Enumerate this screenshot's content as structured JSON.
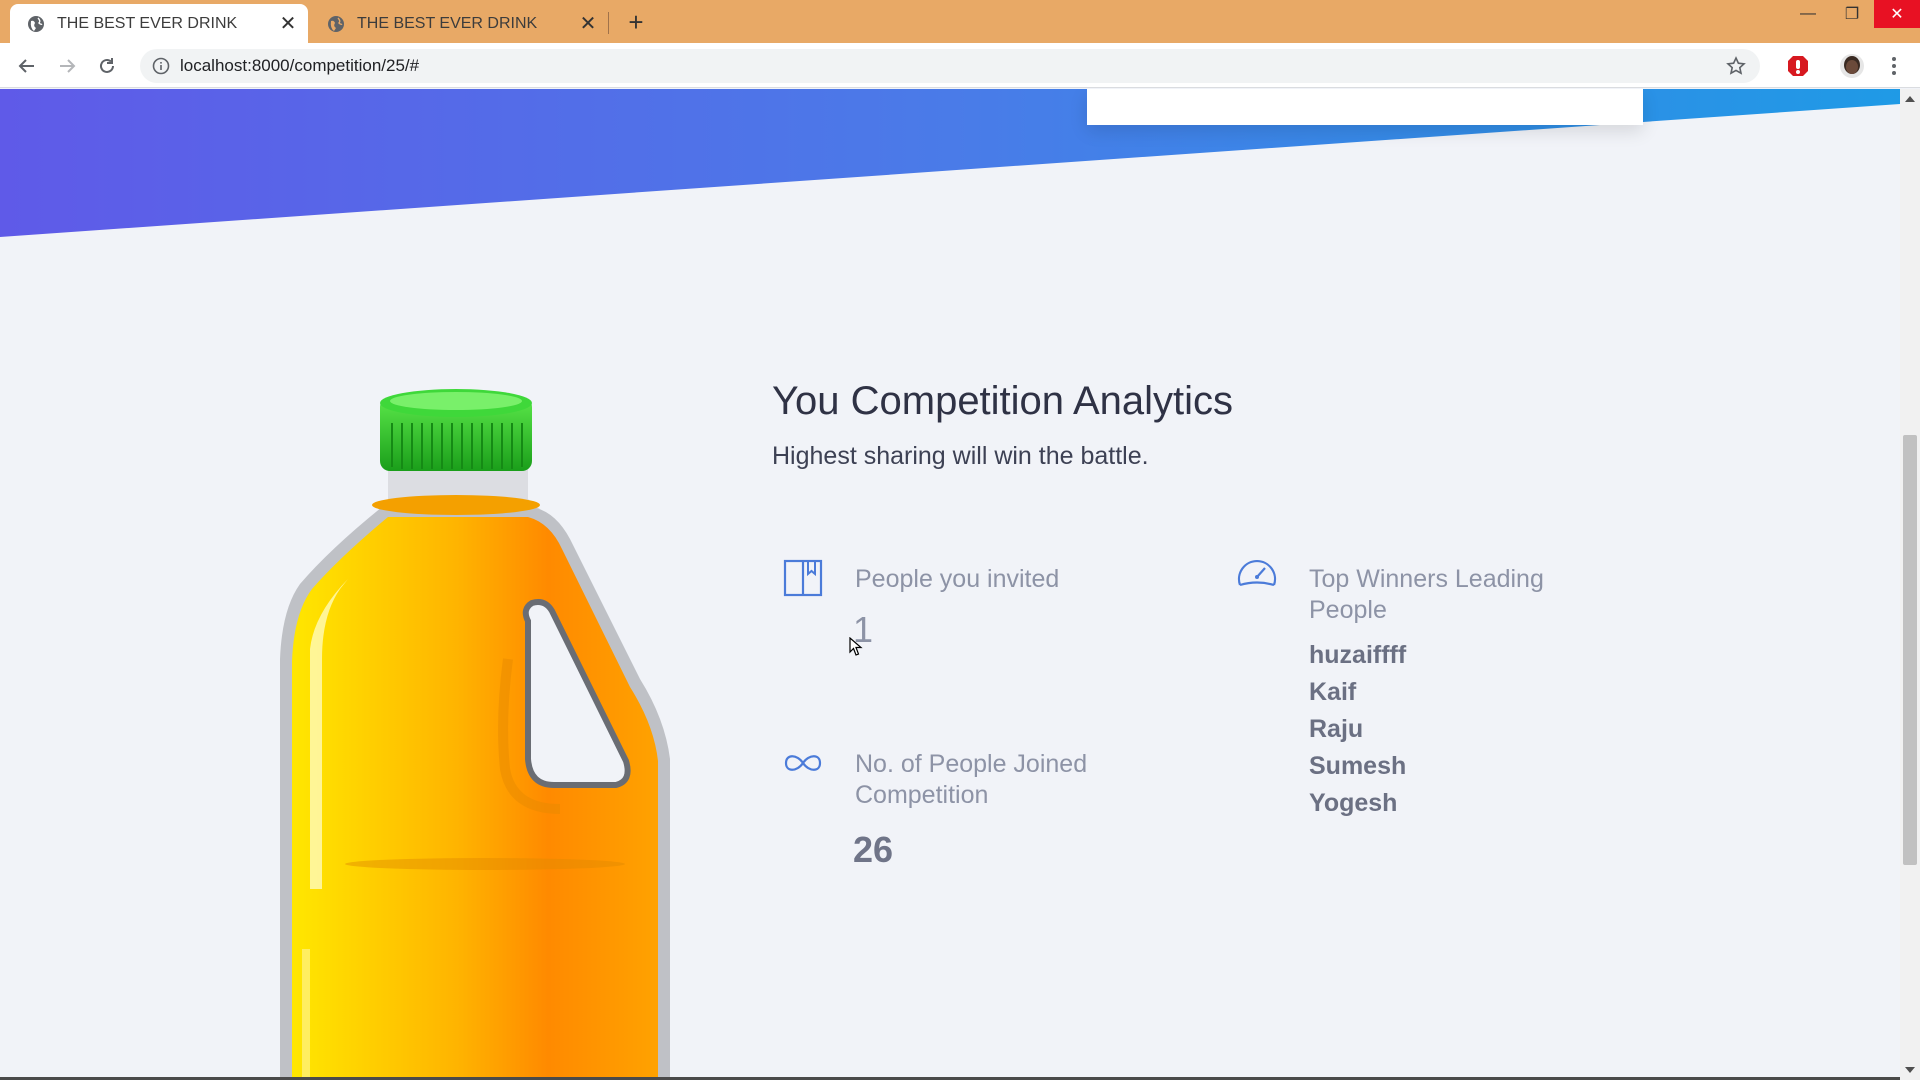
{
  "browser": {
    "tabs": [
      {
        "title": "THE BEST EVER DRINK",
        "active": true
      },
      {
        "title": "THE BEST EVER DRINK",
        "active": false
      }
    ],
    "new_tab_symbol": "+",
    "close_symbol": "✕",
    "url": "localhost:8000/competition/25/#",
    "window_controls": {
      "minimize": "—",
      "maximize": "❐",
      "close": "✕"
    }
  },
  "page": {
    "section_title": "You Competition Analytics",
    "section_subtitle": "Highest sharing will win the battle.",
    "stats": {
      "invited": {
        "label": "People you invited",
        "value": "1",
        "icon": "book-icon"
      },
      "joined": {
        "label_line1": "No. of People Joined",
        "label_line2": "Competition",
        "value": "26",
        "icon": "infinity-icon"
      },
      "winners": {
        "label_line1": "Top Winners Leading",
        "label_line2": "People",
        "icon": "speedometer-icon",
        "names": [
          "huzaiffff",
          "Kaif",
          "Raju",
          "Sumesh",
          "Yogesh"
        ]
      }
    }
  },
  "colors": {
    "titlebar": "#e8a966",
    "hero_gradient_start": "#5f5ae8",
    "hero_gradient_end": "#1f9ae6",
    "accent_icon": "#4b7bd9",
    "background": "#f1f3f8"
  }
}
